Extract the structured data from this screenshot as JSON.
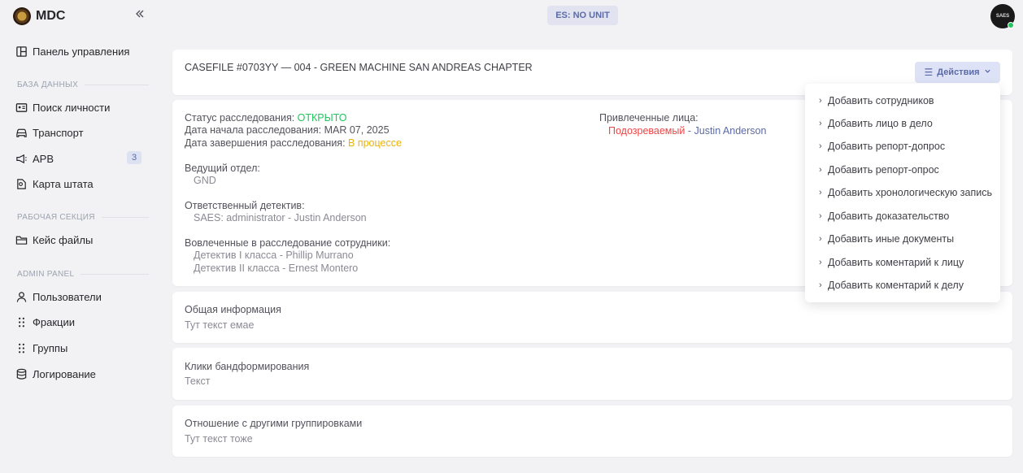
{
  "app": {
    "title": "MDC"
  },
  "topbar": {
    "unit_status": "ES: NO UNIT",
    "avatar_text": "SAES"
  },
  "sidebar": {
    "dashboard": "Панель управления",
    "sections": {
      "database": "БАЗА ДАННЫХ",
      "work": "РАБОЧАЯ СЕКЦИЯ",
      "admin": "ADMIN PANEL"
    },
    "items": {
      "person_search": "Поиск личности",
      "transport": "Транспорт",
      "apb": "APB",
      "apb_count": "3",
      "state_map": "Карта штата",
      "case_files": "Кейс файлы",
      "users": "Пользователи",
      "factions": "Фракции",
      "groups": "Группы",
      "logging": "Логирование"
    }
  },
  "casefile": {
    "title": "CASEFILE #0703YY — 004 - GREEN MACHINE SAN ANDREAS CHAPTER",
    "actions_label": "Действия"
  },
  "details": {
    "status_label": "Статус расследования:",
    "status_value": "ОТКРЫТО",
    "start_label": "Дата начала расследования:",
    "start_value": "MAR 07, 2025",
    "end_label": "Дата завершения расследования:",
    "end_value": "В процессе",
    "dept_label": "Ведущий отдел:",
    "dept_value": "GND",
    "detective_label": "Ответственный детектив:",
    "detective_value": "SAES: administrator - Justin Anderson",
    "involved_label": "Вовлеченные в расследование сотрудники:",
    "involved": [
      "Детектив I класса - Phillip Murrano",
      "Детектив II класса - Ernest Montero"
    ],
    "persons_label": "Привлеченные лица:",
    "person_role": "Подозреваемый",
    "person_name": "- Justin Anderson"
  },
  "sections": [
    {
      "title": "Общая информация",
      "text": "Тут текст емае"
    },
    {
      "title": "Клики бандформирования",
      "text": "Текст"
    },
    {
      "title": "Отношение с другими группировками",
      "text": "Тут текст тоже"
    }
  ],
  "dropdown": {
    "items": [
      "Добавить сотрудников",
      "Добавить лицо в дело",
      "Добавить репорт-допрос",
      "Добавить репорт-опрос",
      "Добавить хронологическую запись",
      "Добавить доказательство",
      "Добавить иные документы",
      "Добавить коментарий к лицу",
      "Добавить коментарий к делу"
    ]
  },
  "colors": {
    "open_status": "#22c55e",
    "in_progress": "#eab308",
    "suspect": "#ef4444",
    "accent": "#5b6aa8"
  }
}
